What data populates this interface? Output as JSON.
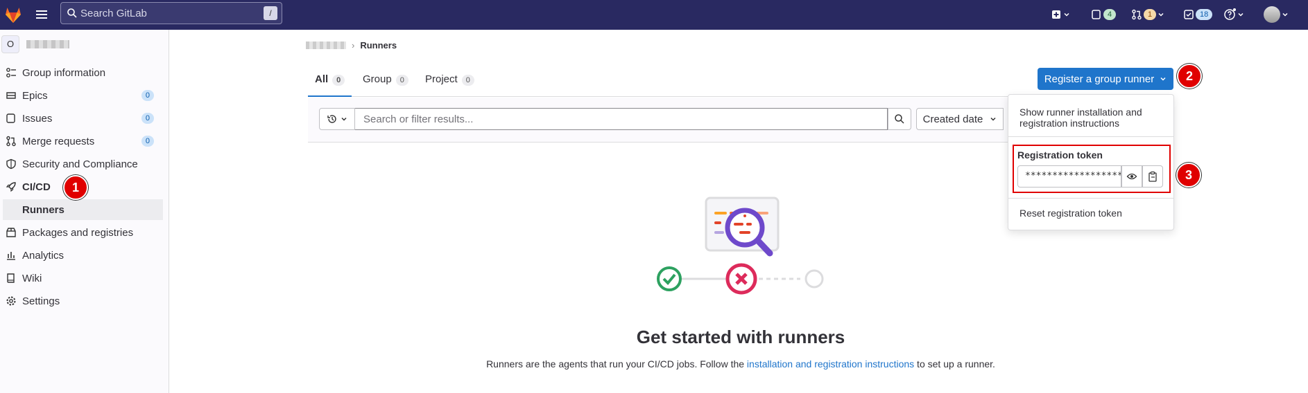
{
  "topbar": {
    "search_placeholder": "Search GitLab",
    "search_shortcut": "/",
    "issues_count": "4",
    "merge_requests_count": "1",
    "todos_count": "18"
  },
  "sidebar": {
    "group_initial": "O",
    "items": [
      {
        "label": "Group information"
      },
      {
        "label": "Epics",
        "count": "0"
      },
      {
        "label": "Issues",
        "count": "0"
      },
      {
        "label": "Merge requests",
        "count": "0"
      },
      {
        "label": "Security and Compliance"
      },
      {
        "label": "CI/CD"
      },
      {
        "label": "Runners"
      },
      {
        "label": "Packages and registries"
      },
      {
        "label": "Analytics"
      },
      {
        "label": "Wiki"
      },
      {
        "label": "Settings"
      }
    ]
  },
  "annotations": {
    "step1": "1",
    "step2": "2",
    "step3": "3"
  },
  "breadcrumb": {
    "current": "Runners"
  },
  "tabs": [
    {
      "label": "All",
      "count": "0"
    },
    {
      "label": "Group",
      "count": "0"
    },
    {
      "label": "Project",
      "count": "0"
    }
  ],
  "register_button": "Register a group runner",
  "filter": {
    "placeholder": "Search or filter results...",
    "sort_label": "Created date"
  },
  "dropdown": {
    "show_instructions": "Show runner installation and registration instructions",
    "token_label": "Registration token",
    "token_value": "****************************",
    "reset_label": "Reset registration token"
  },
  "empty_state": {
    "title": "Get started with runners",
    "desc_before": "Runners are the agents that run your CI/CD jobs. Follow the ",
    "link": "installation and registration instructions",
    "desc_after": " to set up a runner."
  },
  "colors": {
    "topbar": "#292961",
    "primary": "#1f75cb",
    "annotation_red": "#e00000"
  }
}
